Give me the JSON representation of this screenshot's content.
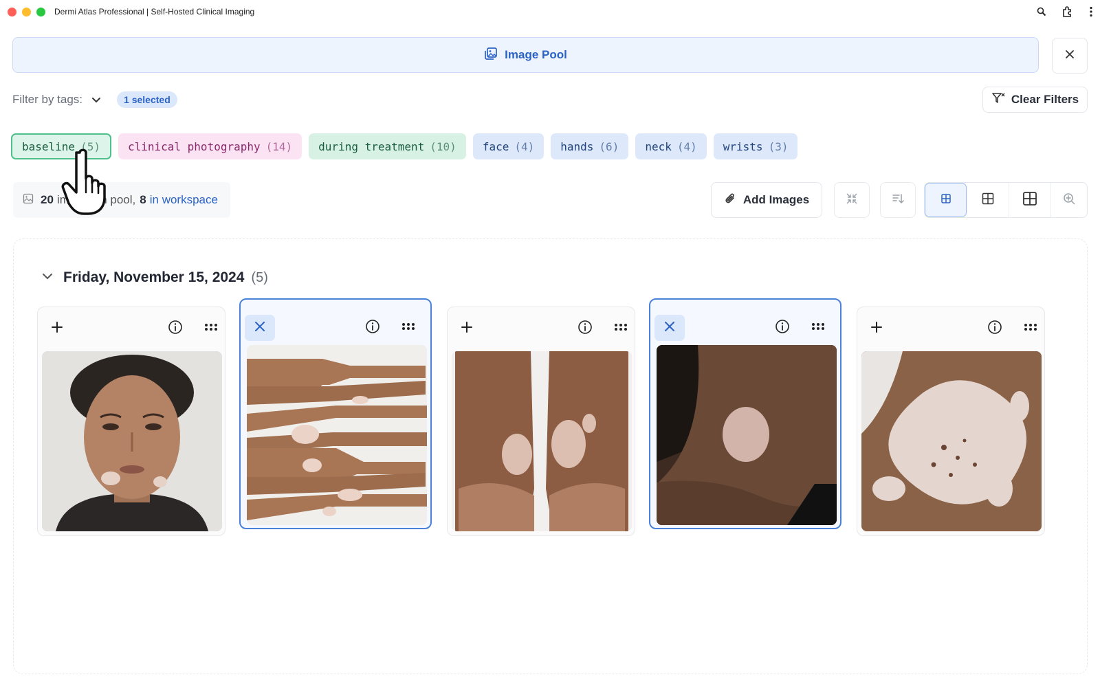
{
  "window": {
    "title": "Dermi Atlas Professional | Self-Hosted Clinical Imaging"
  },
  "pool": {
    "title": "Image Pool"
  },
  "filter": {
    "label": "Filter by tags:",
    "selected_badge": "1 selected",
    "clear_label": "Clear Filters"
  },
  "tags": [
    {
      "name": "baseline",
      "count": "(5)",
      "color": "green",
      "active": true
    },
    {
      "name": "clinical photography",
      "count": "(14)",
      "color": "pink",
      "active": false
    },
    {
      "name": "during treatment",
      "count": "(10)",
      "color": "green",
      "active": false
    },
    {
      "name": "face",
      "count": "(4)",
      "color": "blue",
      "active": false
    },
    {
      "name": "hands",
      "count": "(6)",
      "color": "blue",
      "active": false
    },
    {
      "name": "neck",
      "count": "(4)",
      "color": "blue",
      "active": false
    },
    {
      "name": "wrists",
      "count": "(3)",
      "color": "blue",
      "active": false
    }
  ],
  "summary": {
    "total": "20",
    "text": "images in pool,",
    "workspace_count": "8",
    "workspace_label": "in workspace"
  },
  "toolbar": {
    "add_images_label": "Add Images"
  },
  "group": {
    "title": "Friday, November 15, 2024",
    "count": "(5)"
  },
  "images": [
    {
      "subject": "face",
      "in_workspace": false
    },
    {
      "subject": "hands",
      "in_workspace": true
    },
    {
      "subject": "wrists",
      "in_workspace": false
    },
    {
      "subject": "neck",
      "in_workspace": true
    },
    {
      "subject": "shoulder",
      "in_workspace": false
    }
  ],
  "colors": {
    "accent": "#2b63c4",
    "selected_border": "#4a82d9",
    "tag_green": "#d7f2e4",
    "tag_pink": "#fbe3f3",
    "tag_blue": "#dde8fb"
  }
}
